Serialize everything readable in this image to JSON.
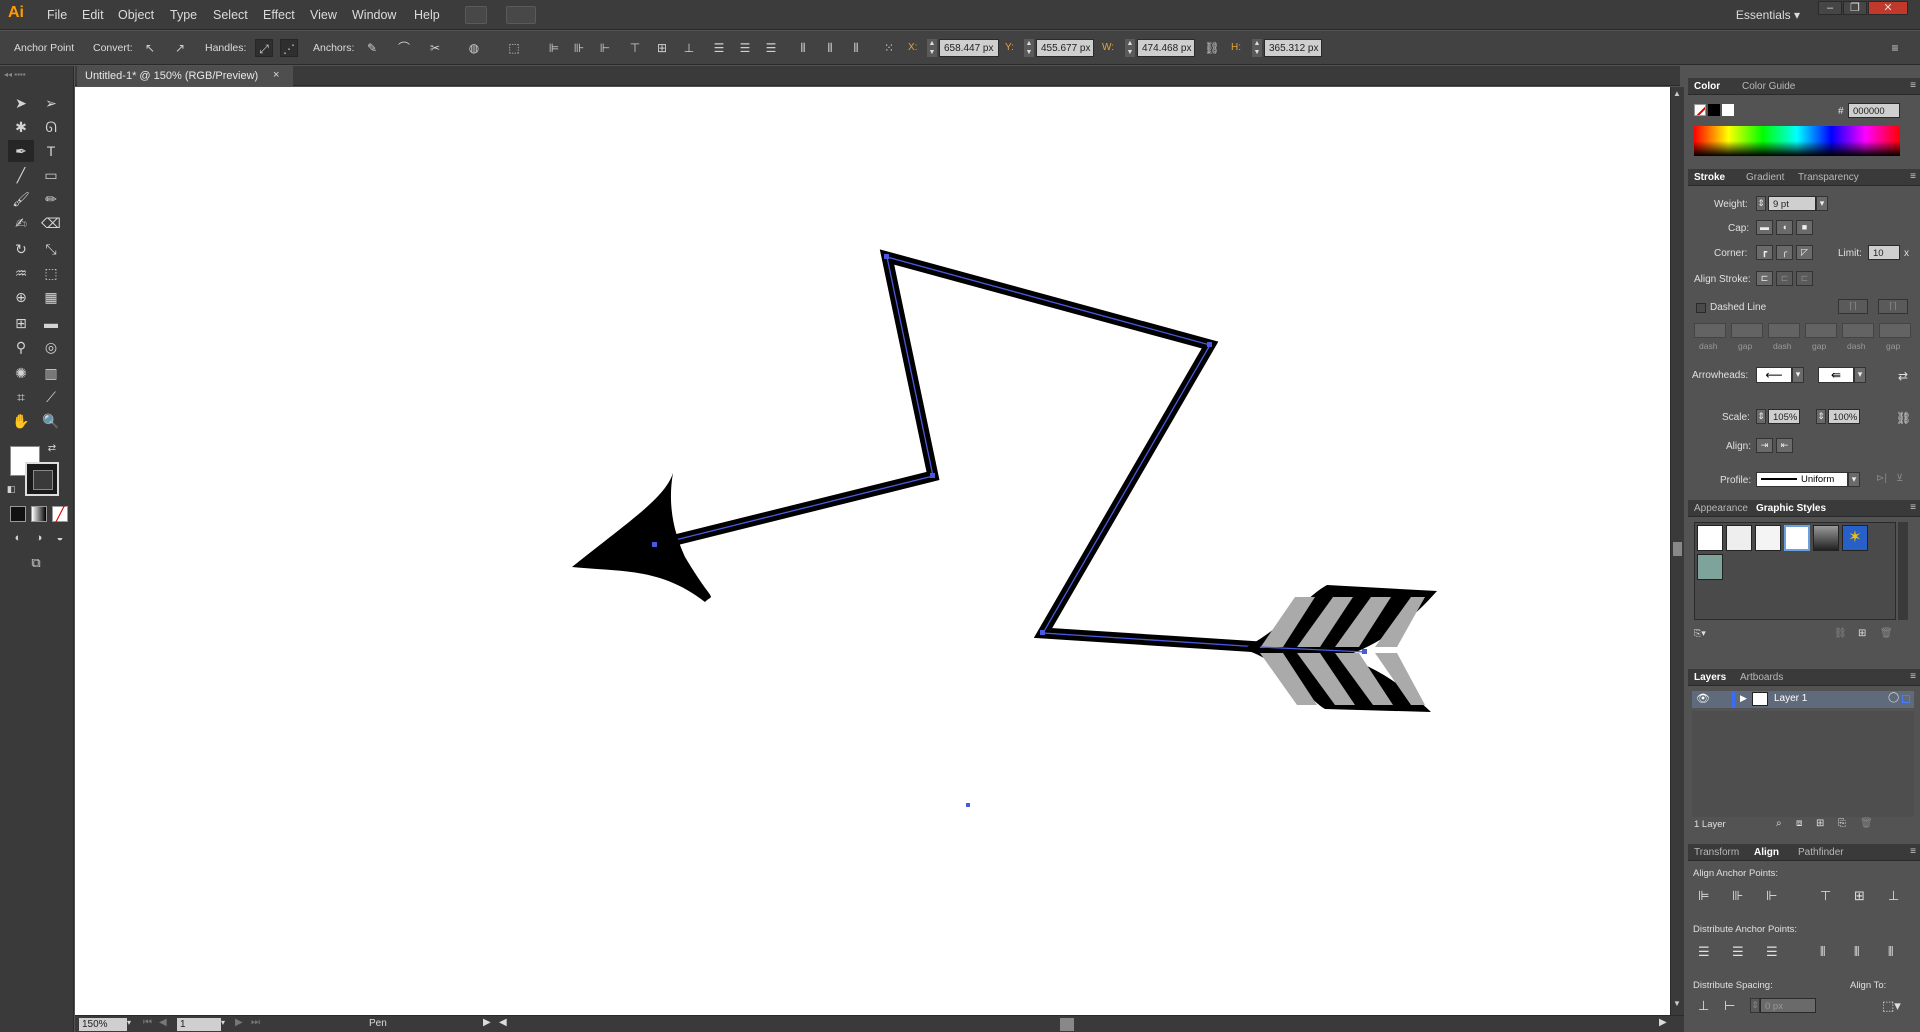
{
  "app": {
    "logo": "Ai",
    "menu": [
      "File",
      "Edit",
      "Object",
      "Type",
      "Select",
      "Effect",
      "View",
      "Window",
      "Help"
    ],
    "workspace": "Essentials",
    "workspace_arrow": "▾",
    "window_buttons": [
      "–",
      "❐",
      "✕"
    ]
  },
  "control_bar": {
    "tool_name": "Anchor Point",
    "convert_label": "Convert:",
    "handles_label": "Handles:",
    "anchors_label": "Anchors:",
    "x_label": "X:",
    "x_value": "658.447 px",
    "y_label": "Y:",
    "y_value": "455.677 px",
    "w_label": "W:",
    "w_value": "474.468 px",
    "h_label": "H:",
    "h_value": "365.312 px"
  },
  "document": {
    "tab_title": "Untitled-1* @ 150% (RGB/Preview)",
    "tab_close": "×"
  },
  "status": {
    "zoom": "150%",
    "artboard": "1",
    "current_tool": "Pen"
  },
  "color_panel": {
    "tabs": [
      "Color",
      "Color Guide"
    ],
    "hex_label": "#",
    "hex_value": "000000"
  },
  "stroke_panel": {
    "tabs": [
      "Stroke",
      "Gradient",
      "Transparency"
    ],
    "weight_label": "Weight:",
    "weight_value": "9 pt",
    "cap_label": "Cap:",
    "corner_label": "Corner:",
    "limit_label": "Limit:",
    "limit_value": "10",
    "limit_unit": "x",
    "align_stroke_label": "Align Stroke:",
    "dashed_line_label": "Dashed Line",
    "dash_labels": [
      "dash",
      "gap",
      "dash",
      "gap",
      "dash",
      "gap"
    ],
    "arrowheads_label": "Arrowheads:",
    "scale_label": "Scale:",
    "scale_start": "105%",
    "scale_end": "100%",
    "align_label": "Align:",
    "profile_label": "Profile:",
    "profile_value": "Uniform"
  },
  "styles_panel": {
    "tabs": [
      "Appearance",
      "Graphic Styles"
    ]
  },
  "layers_panel": {
    "tabs": [
      "Layers",
      "Artboards"
    ],
    "layer_name": "Layer 1",
    "footer": "1 Layer"
  },
  "align_panel": {
    "tabs": [
      "Transform",
      "Align",
      "Pathfinder"
    ],
    "align_anchor_points": "Align Anchor Points:",
    "distribute_anchor_points": "Distribute Anchor Points:",
    "distribute_spacing": "Distribute Spacing:",
    "align_to": "Align To:",
    "spacing_value": "0 px"
  },
  "colors": {
    "ui_dark": "#3c3c3c",
    "ui_panel": "#535353",
    "path_selection": "#4a5adf",
    "accent_orange": "#ff9a00"
  }
}
